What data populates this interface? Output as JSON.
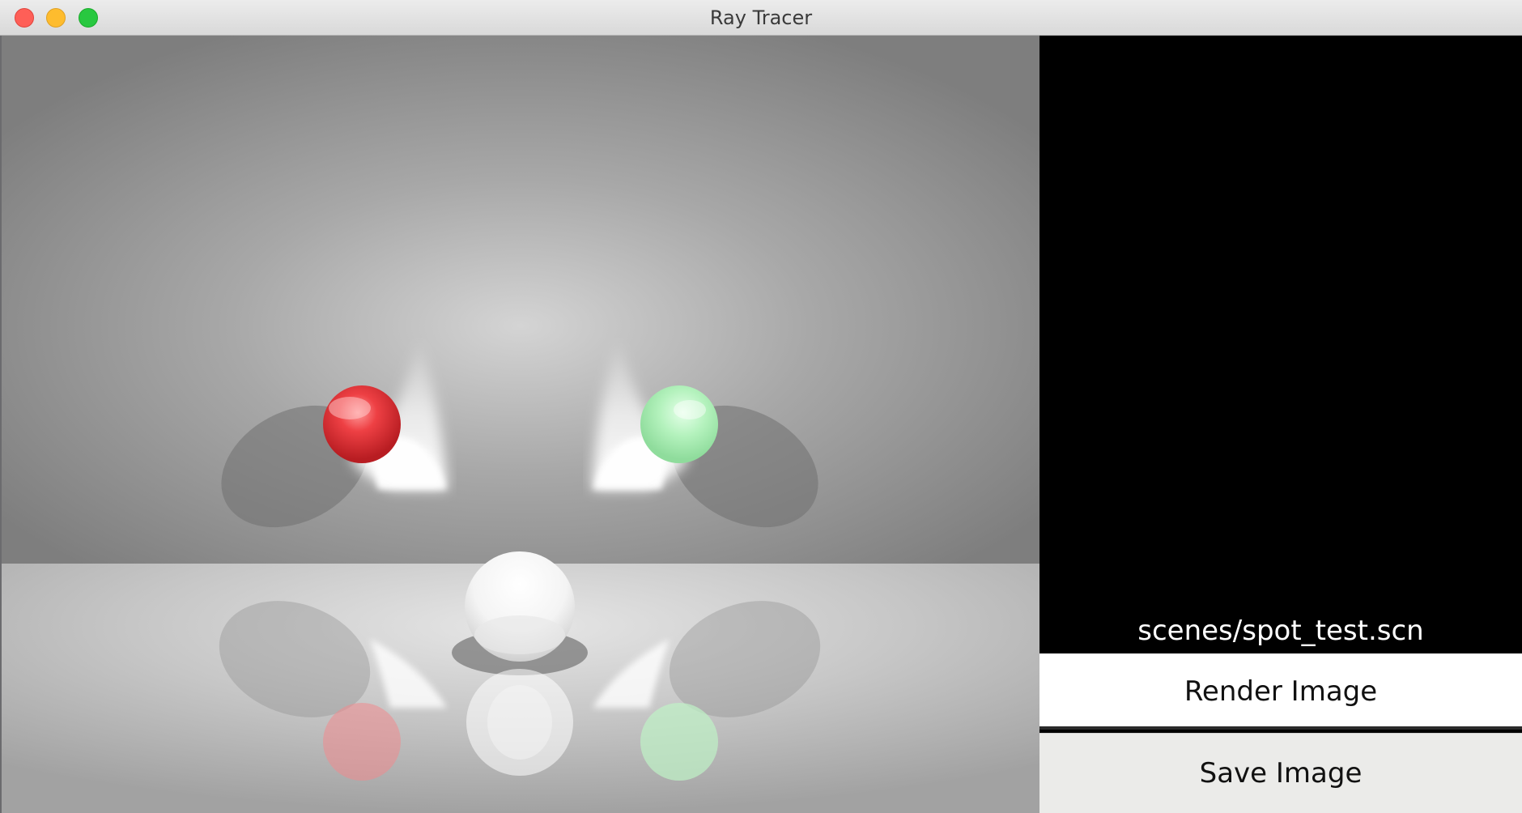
{
  "window": {
    "title": "Ray Tracer"
  },
  "sidebar": {
    "scene_file": "scenes/spot_test.scn",
    "render_button_label": "Render Image",
    "save_button_label": "Save Image"
  },
  "colors": {
    "red_sphere": "#e8313a",
    "green_sphere": "#a9f0b4",
    "wall": "#9c9c9c",
    "floor": "#c2c2c2",
    "sidebar_background": "#000000"
  }
}
